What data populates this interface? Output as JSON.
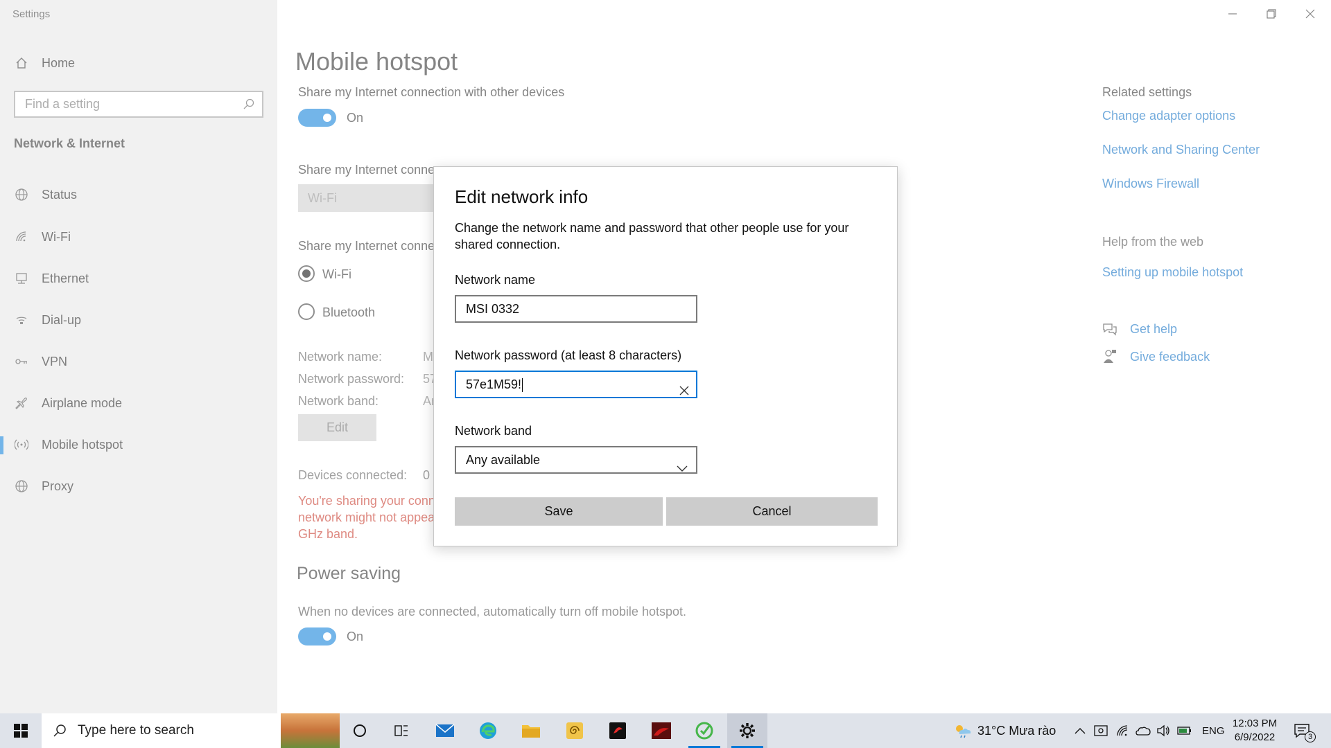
{
  "app": {
    "title": "Settings"
  },
  "sidebar": {
    "home_label": "Home",
    "search_placeholder": "Find a setting",
    "section_title": "Network & Internet",
    "items": [
      {
        "label": "Status",
        "icon": "globe-icon"
      },
      {
        "label": "Wi-Fi",
        "icon": "wifi-icon"
      },
      {
        "label": "Ethernet",
        "icon": "ethernet-icon"
      },
      {
        "label": "Dial-up",
        "icon": "dialup-icon"
      },
      {
        "label": "VPN",
        "icon": "vpn-icon"
      },
      {
        "label": "Airplane mode",
        "icon": "airplane-icon"
      },
      {
        "label": "Mobile hotspot",
        "icon": "hotspot-icon",
        "active": true
      },
      {
        "label": "Proxy",
        "icon": "globe-icon"
      }
    ]
  },
  "main": {
    "title": "Mobile hotspot",
    "share_label": "Share my Internet connection with other devices",
    "share_toggle": "On",
    "share_from_label": "Share my Internet connec",
    "share_from_value": "Wi-Fi",
    "share_over_label": "Share my Internet connec",
    "radio_wifi": "Wi-Fi",
    "radio_bluetooth": "Bluetooth",
    "network_name_label": "Network name:",
    "network_name_value": "M",
    "network_password_label": "Network password:",
    "network_password_value": "57",
    "network_band_label": "Network band:",
    "network_band_value": "Ar",
    "edit_button": "Edit",
    "devices_label": "Devices connected:",
    "devices_value": "0",
    "warning_lines": [
      "You're sharing your conne",
      "network might not appea",
      "GHz band."
    ],
    "power_title": "Power saving",
    "power_desc": "When no devices are connected, automatically turn off mobile hotspot.",
    "power_toggle": "On"
  },
  "related": {
    "heading": "Related settings",
    "links": [
      "Change adapter options",
      "Network and Sharing Center",
      "Windows Firewall"
    ],
    "help_heading": "Help from the web",
    "help_link": "Setting up mobile hotspot",
    "get_help": "Get help",
    "give_feedback": "Give feedback"
  },
  "dialog": {
    "title": "Edit network info",
    "description": "Change the network name and password that other people use for your shared connection.",
    "name_label": "Network name",
    "name_value": "MSI 0332",
    "password_label": "Network password (at least 8 characters)",
    "password_value": "57e1M59!",
    "band_label": "Network band",
    "band_value": "Any available",
    "save": "Save",
    "cancel": "Cancel"
  },
  "taskbar": {
    "search_placeholder": "Type here to search",
    "weather": "31°C  Mưa rào",
    "lang": "ENG",
    "time": "12:03 PM",
    "date": "6/9/2022",
    "notifications": "3"
  },
  "colors": {
    "accent": "#0078d7",
    "link": "#0067c0",
    "warning": "#c42b1c",
    "sidebar_bg": "#e6e6e6"
  }
}
